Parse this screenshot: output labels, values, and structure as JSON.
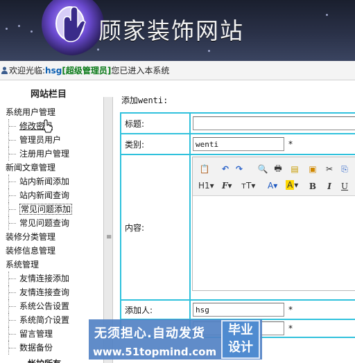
{
  "site": {
    "title": "顾家装饰网站"
  },
  "welcome": {
    "prefix": "欢迎光临:",
    "user": "hsg",
    "role": "[超级管理员]",
    "suffix": "您已进入本系统"
  },
  "sidebar": {
    "heading": "网站栏目",
    "groups": [
      {
        "label": "系统用户管理",
        "items": [
          "修改密码",
          "管理员用户",
          "注册用户管理"
        ]
      },
      {
        "label": "新闻文章管理",
        "items": [
          "站内新闻添加",
          "站内新闻查询",
          "常见问题添加",
          "常见问题查询"
        ]
      },
      {
        "label": "装修分类管理",
        "items": []
      },
      {
        "label": "装修信息管理",
        "items": []
      },
      {
        "label": "系统管理",
        "items": [
          "友情连接添加",
          "友情连接查询",
          "系统公告设置",
          "系统简介设置",
          "留言管理",
          "数据备份"
        ]
      }
    ],
    "footer_cut": "帐护所有"
  },
  "main": {
    "heading": "添加wenti:",
    "form": {
      "title_label": "标题:",
      "title_value": "",
      "category_label": "类别:",
      "category_value": "wenti",
      "content_label": "内容:",
      "adder_label": "添加人:",
      "adder_value": "hsg",
      "required_mark": "*"
    },
    "toolbar": {
      "row2": [
        "H1",
        "F",
        "тT",
        "A",
        "A",
        "B",
        "I",
        "U"
      ]
    }
  },
  "watermark": {
    "line1": "无须担心.自动发货",
    "line2": "www.51topmind.com",
    "seal_line1": "毕业",
    "seal_line2": "设计"
  }
}
